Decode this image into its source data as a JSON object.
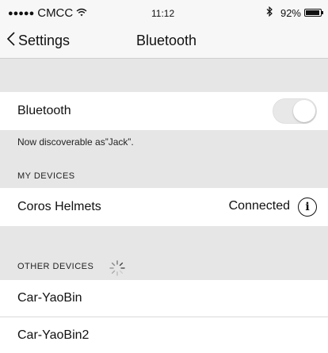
{
  "status": {
    "carrier": "CMCC",
    "time": "11:12",
    "battery": "92%",
    "battery_level": 0.92,
    "icons": [
      "signal-dots-icon",
      "wifi-icon",
      "bluetooth-icon",
      "battery-icon"
    ]
  },
  "nav": {
    "back_label": "Settings",
    "title": "Bluetooth"
  },
  "bluetooth_row": {
    "label": "Bluetooth",
    "toggle_state": "off"
  },
  "discoverable": "Now discoverable as”Jack”.",
  "my_devices": {
    "header": "MY DEVICES",
    "items": [
      {
        "name": "Coros Helmets",
        "status": "Connected"
      }
    ]
  },
  "other_devices": {
    "header": "OTHER DEVICES",
    "items": [
      {
        "name": "Car-YaoBin"
      },
      {
        "name": "Car-YaoBin2"
      }
    ]
  },
  "colors": {
    "background": "#e6e6e6",
    "row": "#ffffff",
    "bar": "#f7f7f7"
  }
}
